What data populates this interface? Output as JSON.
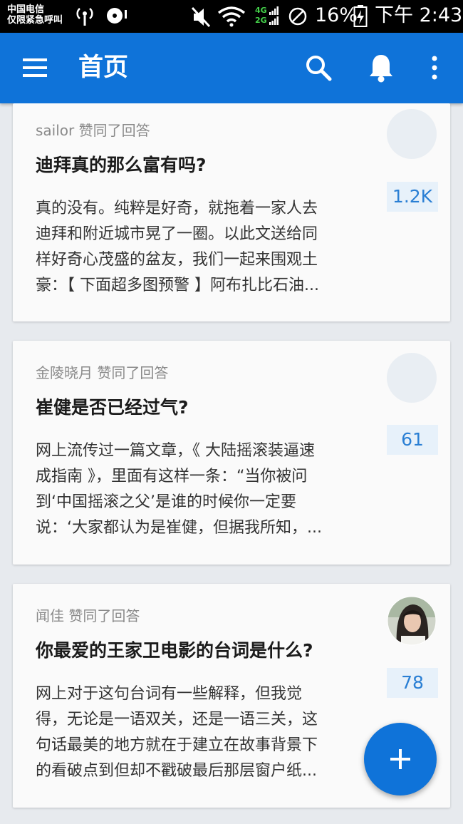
{
  "status_bar": {
    "carrier_line1": "中国电信",
    "carrier_line2": "仅限紧急呼叫",
    "network_4g": "4G",
    "network_2g": "2G",
    "battery": "16%",
    "time": "下午 2:43"
  },
  "app_bar": {
    "title": "首页",
    "color": "#0f73d9"
  },
  "feed": [
    {
      "actor": "sailor 赞同了回答",
      "question": "迪拜真的那么富有吗?",
      "excerpt_lines": [
        "真的没有。纯粹是好奇，就拖着一家人去",
        "迪拜和附近城市晃了一圈。以此文送给同",
        "样好奇心茂盛的盆友，我们一起来围观土",
        "豪：【 下面超多图预警 】阿布扎比石油..."
      ],
      "votes": "1.2K",
      "avatar": "placeholder"
    },
    {
      "actor": "金陵晓月 赞同了回答",
      "question": "崔健是否已经过气?",
      "excerpt_lines": [
        "网上流传过一篇文章，《 大陆摇滚装逼速",
        "成指南 》，里面有这样一条：“当你被问",
        "到‘中国摇滚之父’是谁的时候你一定要",
        "说：‘大家都认为是崔健，但据我所知，..."
      ],
      "votes": "61",
      "avatar": "placeholder"
    },
    {
      "actor": "闻佳 赞同了回答",
      "question": "你最爱的王家卫电影的台词是什么?",
      "excerpt_lines": [
        "网上对于这句台词有一些解释，但我觉",
        "得，无论是一语双关，还是一语三关，这",
        "句话最美的地方就在于建立在故事背景下",
        "的看破点到但却不戳破最后那层窗户纸..."
      ],
      "votes": "78",
      "avatar": "photo"
    }
  ]
}
